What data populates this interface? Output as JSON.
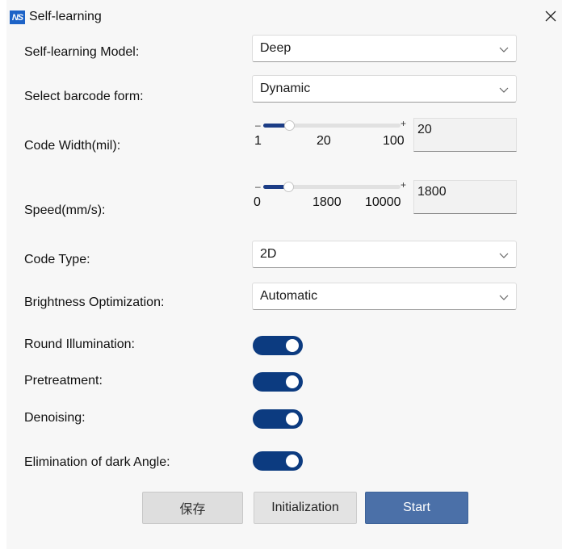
{
  "window": {
    "title": "Self-learning",
    "logo_text": "NS",
    "close_icon": "close-icon"
  },
  "fields": {
    "model": {
      "label": "Self-learning Model:",
      "value": "Deep"
    },
    "barcode_form": {
      "label": "Select barcode form:",
      "value": "Dynamic"
    },
    "code_width": {
      "label": "Code Width(mil):",
      "min": "1",
      "mid": "20",
      "max": "100",
      "value": "20",
      "fraction": 0.19
    },
    "speed": {
      "label": "Speed(mm/s):",
      "min": "0",
      "mid": "1800",
      "max": "10000",
      "value": "1800",
      "fraction": 0.18
    },
    "code_type": {
      "label": "Code Type:",
      "value": "2D"
    },
    "brightness": {
      "label": "Brightness Optimization:",
      "value": "Automatic"
    },
    "round_illumination": {
      "label": "Round Illumination:",
      "on": true
    },
    "pretreatment": {
      "label": "Pretreatment:",
      "on": true
    },
    "denoising": {
      "label": "Denoising:",
      "on": true
    },
    "dark_angle": {
      "label": "Elimination of dark Angle:",
      "on": true
    }
  },
  "slider_signs": {
    "minus": "–",
    "plus": "+"
  },
  "buttons": {
    "save": "保存",
    "init": "Initialization",
    "start": "Start"
  },
  "colors": {
    "accent": "#0c3b80",
    "slider_fill": "#1c3d86",
    "start_button": "#4b70a8",
    "logo": "#1d63c7"
  }
}
